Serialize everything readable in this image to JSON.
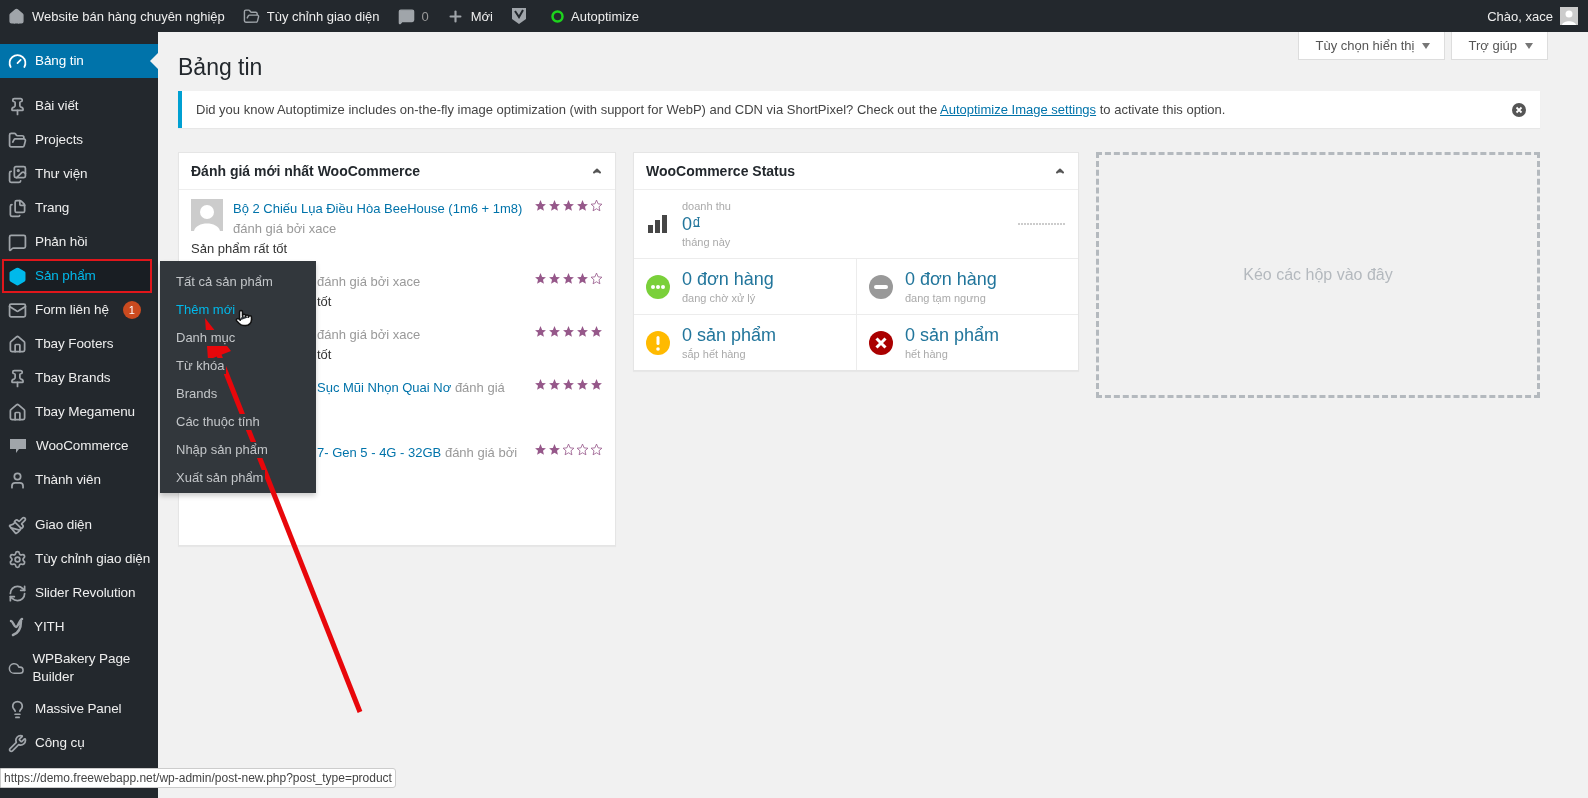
{
  "topbar": {
    "site_name": "Website bán hàng chuyên nghiệp",
    "customize": "Tùy chỉnh giao diện",
    "comments": "0",
    "new": "Mới",
    "autoptimize": "Autoptimize",
    "greeting": "Chào, xace"
  },
  "sidebar": {
    "groups": [
      [
        {
          "label": "Bảng tin",
          "selected": true,
          "hovered": false,
          "framed": false
        }
      ],
      [
        {
          "label": "Bài viết",
          "selected": false,
          "hovered": false,
          "framed": false
        },
        {
          "label": "Projects",
          "selected": false,
          "hovered": false,
          "framed": false
        },
        {
          "label": "Thư viện",
          "selected": false,
          "hovered": false,
          "framed": false
        },
        {
          "label": "Trang",
          "selected": false,
          "hovered": false,
          "framed": false
        },
        {
          "label": "Phản hồi",
          "selected": false,
          "hovered": false,
          "framed": false
        },
        {
          "label": "Sản phẩm",
          "selected": false,
          "hovered": true,
          "framed": true,
          "submenu": [
            {
              "label": "Tất cả sản phẩm",
              "hovered": false
            },
            {
              "label": "Thêm mới",
              "hovered": true
            },
            {
              "label": "Danh mục",
              "hovered": false
            },
            {
              "label": "Từ khóa",
              "hovered": false
            },
            {
              "label": "Brands",
              "hovered": false
            },
            {
              "label": "Các thuộc tính",
              "hovered": false
            },
            {
              "label": "Nhập sản phẩm",
              "hovered": false
            },
            {
              "label": "Xuất sản phẩm",
              "hovered": false
            }
          ]
        },
        {
          "label": "Form liên hệ",
          "selected": false,
          "hovered": false,
          "framed": false,
          "badge": "1"
        },
        {
          "label": "Tbay Footers",
          "selected": false,
          "hovered": false,
          "framed": false
        },
        {
          "label": "Tbay Brands",
          "selected": false,
          "hovered": false,
          "framed": false
        },
        {
          "label": "Tbay Megamenu",
          "selected": false,
          "hovered": false,
          "framed": false
        },
        {
          "label": "WooCommerce",
          "selected": false,
          "hovered": false,
          "framed": false
        },
        {
          "label": "Thành viên",
          "selected": false,
          "hovered": false,
          "framed": false
        }
      ],
      [
        {
          "label": "Giao diện",
          "selected": false,
          "hovered": false,
          "framed": false
        },
        {
          "label": "Tùy chỉnh giao diện",
          "selected": false,
          "hovered": false,
          "framed": false
        },
        {
          "label": "Slider Revolution",
          "selected": false,
          "hovered": false,
          "framed": false
        },
        {
          "label": "YITH",
          "selected": false,
          "hovered": false,
          "framed": false
        },
        {
          "label": "WPBakery Page Builder",
          "selected": false,
          "hovered": false,
          "framed": false
        },
        {
          "label": "Massive Panel",
          "selected": false,
          "hovered": false,
          "framed": false
        },
        {
          "label": "Công cụ",
          "selected": false,
          "hovered": false,
          "framed": false
        }
      ]
    ]
  },
  "page": {
    "title": "Bảng tin",
    "screen_options": "Tùy chọn hiển thị",
    "help": "Trợ giúp"
  },
  "notice": {
    "text_before": "Did you know Autoptimize includes on-the-fly image optimization (with support for WebP) and CDN via ShortPixel? Check out the ",
    "link": "Autoptimize Image settings",
    "text_after": " to activate this option."
  },
  "reviews_widget": {
    "title": "Đánh giá mới nhất WooCommerce",
    "reviews": [
      {
        "avatar": true,
        "product": "Bộ 2 Chiếu Lụa Điều Hòa BeeHouse (1m6 + 1m8)",
        "by": "đánh giá bởi xace",
        "comment": "Sản phẩm rất tốt",
        "stars": 4
      },
      {
        "avatar": false,
        "by": "đánh giá bởi xace",
        "comment": "tốt",
        "stars": 4
      },
      {
        "avatar": false,
        "by": "đánh giá bởi xace",
        "comment": "tốt",
        "stars": 5
      },
      {
        "avatar": false,
        "product": "Sục Mũi Nhọn Quai Nơ",
        "by": "đánh giá",
        "stars": 5
      },
      {
        "avatar": false,
        "product": "7- Gen 5 - 4G - 32GB",
        "by": "đánh giá bởi",
        "stars": 2
      }
    ]
  },
  "status_widget": {
    "title": "WooCommerce Status",
    "revenue": {
      "label": "doanh thu",
      "amount": "0₫",
      "period": "tháng này"
    },
    "tiles": [
      {
        "kind": "processing",
        "value": "0 đơn hàng",
        "label": "đang chờ xử lý"
      },
      {
        "kind": "on-hold",
        "value": "0 đơn hàng",
        "label": "đang tạm ngưng"
      },
      {
        "kind": "low-stock",
        "value": "0 sản phẩm",
        "label": "sắp hết hàng"
      },
      {
        "kind": "out-of-stock",
        "value": "0 sản phẩm",
        "label": "hết hàng"
      }
    ]
  },
  "drop_zone": {
    "text": "Kéo các hộp vào đây"
  },
  "status_url": "https://demo.freewebapp.net/wp-admin/post-new.php?post_type=product",
  "annotation": {
    "arrow": true
  }
}
